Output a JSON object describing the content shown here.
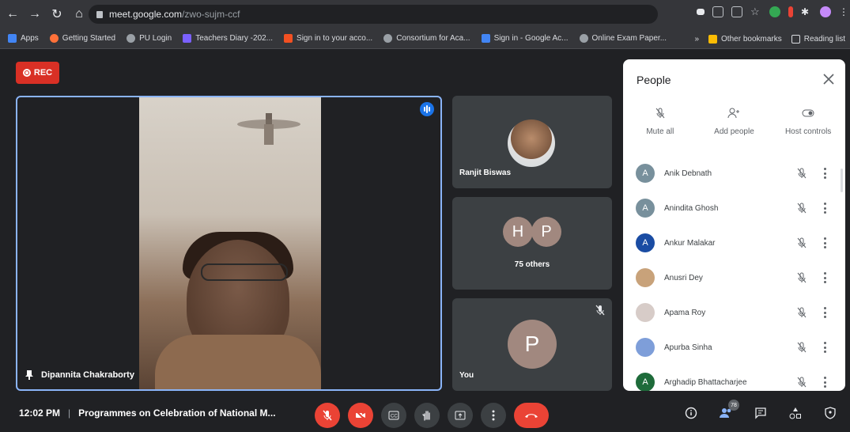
{
  "browser": {
    "url_host": "meet.google.com",
    "url_path": "/zwo-sujm-ccf",
    "bookmarks": [
      {
        "label": "Apps",
        "color": "#4285f4"
      },
      {
        "label": "Getting Started",
        "color": "#ff7139"
      },
      {
        "label": "PU Login",
        "color": "#9aa0a6"
      },
      {
        "label": "Teachers Diary -202...",
        "color": "#7b61ff"
      },
      {
        "label": "Sign in to your acco...",
        "color": "#f25022"
      },
      {
        "label": "Consortium for Aca...",
        "color": "#9aa0a6"
      },
      {
        "label": "Sign in - Google Ac...",
        "color": "#4285f4"
      },
      {
        "label": "Online Exam Paper...",
        "color": "#9aa0a6"
      }
    ],
    "other_bookmarks": "Other bookmarks",
    "reading_list": "Reading list",
    "overflow": "»"
  },
  "meet": {
    "rec_label": "REC",
    "main_speaker": "Dipannita Chakraborty",
    "tiles": {
      "ranjit": "Ranjit Biswas",
      "others_initials": [
        "H",
        "P"
      ],
      "others_label": "75 others",
      "you_initial": "P",
      "you_label": "You"
    }
  },
  "people_panel": {
    "title": "People",
    "actions": {
      "mute_all": "Mute all",
      "add_people": "Add people",
      "host_controls": "Host controls"
    },
    "participants": [
      {
        "name": "Anik Debnath",
        "initial": "A",
        "color": "#78909c"
      },
      {
        "name": "Anindita Ghosh",
        "initial": "A",
        "color": "#78909c"
      },
      {
        "name": "Ankur Malakar",
        "initial": "A",
        "color": "#1a4ca3"
      },
      {
        "name": "Anusri Dey",
        "initial": "",
        "color": "#c8a27a"
      },
      {
        "name": "Apama Roy",
        "initial": "",
        "color": "#d7ccc8"
      },
      {
        "name": "Apurba Sinha",
        "initial": "",
        "color": "#7e9ed9"
      },
      {
        "name": "Arghadip Bhattacharjee",
        "initial": "A",
        "color": "#1e6b3a"
      }
    ]
  },
  "bottom_bar": {
    "time": "12:02 PM",
    "meeting_title": "Programmes on Celebration of National M...",
    "participant_count": "78"
  }
}
